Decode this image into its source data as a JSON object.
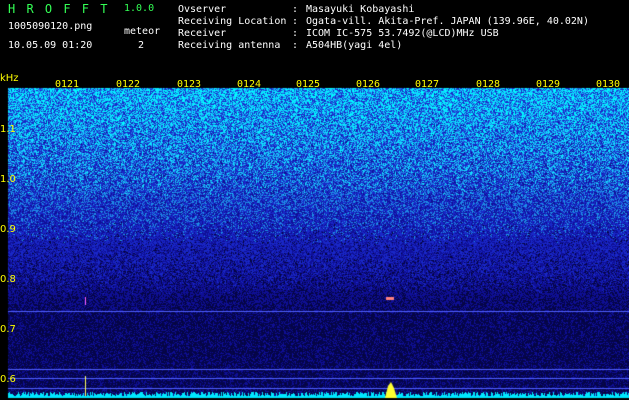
{
  "app": {
    "name": "H R O F F T",
    "version": "1.0.0"
  },
  "file": {
    "name": "1005090120.png",
    "datetime": "10.05.09 01:20"
  },
  "meteor": {
    "label": "meteor",
    "count": "2"
  },
  "station": [
    {
      "key": "Ovserver",
      "value": "Masayuki Kobayashi"
    },
    {
      "key": "Receiving Location",
      "value": "Ogata-vill. Akita-Pref. JAPAN (139.96E, 40.02N)"
    },
    {
      "key": "Receiver",
      "value": "ICOM IC-575 53.7492(@LCD)MHz USB"
    },
    {
      "key": "Receiving antenna",
      "value": "A504HB(yagi 4el)"
    }
  ],
  "separator": ":",
  "axis": {
    "y_unit": "kHz",
    "x_ticks": [
      "0121",
      "0122",
      "0123",
      "0124",
      "0125",
      "0126",
      "0127",
      "0128",
      "0129",
      "0130"
    ],
    "y_ticks": [
      "1.1",
      "1.0",
      "0.9",
      "0.8",
      "0.7",
      "0.6"
    ]
  },
  "colors": {
    "background": "#000000",
    "accent_green": "#33ff55",
    "label_yellow": "#ffff00",
    "noise_high": "#00ffff",
    "noise_low": "#1010a0",
    "marker_line": "#5060ff"
  }
}
